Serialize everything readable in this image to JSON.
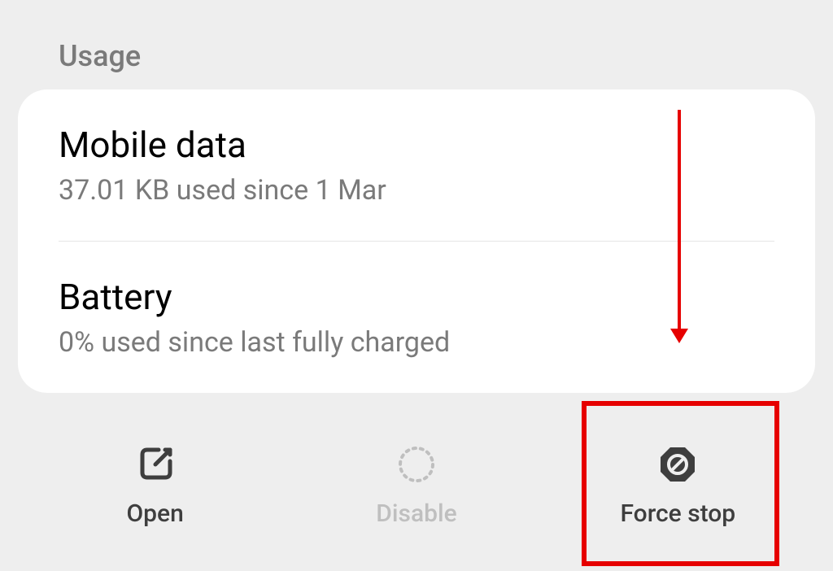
{
  "section": {
    "header": "Usage"
  },
  "items": [
    {
      "title": "Mobile data",
      "subtitle": "37.01 KB used since 1 Mar"
    },
    {
      "title": "Battery",
      "subtitle": "0% used since last fully charged"
    }
  ],
  "bottomBar": {
    "open": "Open",
    "disable": "Disable",
    "forceStop": "Force stop"
  }
}
